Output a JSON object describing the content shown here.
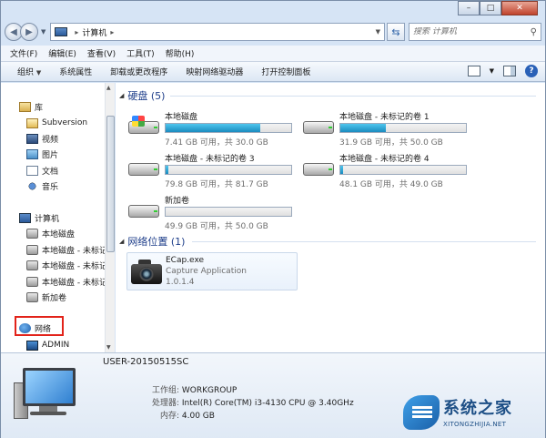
{
  "address": {
    "segments": [
      "计算机"
    ],
    "search_placeholder": "搜索 计算机"
  },
  "menubar": [
    "文件(F)",
    "编辑(E)",
    "查看(V)",
    "工具(T)",
    "帮助(H)"
  ],
  "commands": {
    "organize": "组织",
    "properties": "系统属性",
    "uninstall": "卸载或更改程序",
    "map_drive": "映射网络驱动器",
    "control_panel": "打开控制面板"
  },
  "nav": {
    "library": "库",
    "subversion": "Subversion",
    "video": "视频",
    "pictures": "图片",
    "documents": "文档",
    "music": "音乐",
    "computer": "计算机",
    "drive_local": "本地磁盘",
    "drive_unlabeled_1": "本地磁盘 - 未标记",
    "drive_unlabeled_2": "本地磁盘 - 未标记",
    "drive_unlabeled_3": "本地磁盘 - 未标记",
    "new_volume": "新加卷",
    "network": "网络",
    "admin": "ADMIN"
  },
  "groups": {
    "hard_disks": "硬盘 (5)",
    "network_locations": "网络位置 (1)"
  },
  "drives": [
    {
      "name": "本地磁盘",
      "free": "7.41 GB 可用，共 30.0 GB",
      "used_fraction": 0.75
    },
    {
      "name": "本地磁盘 - 未标记的卷 1",
      "free": "31.9 GB 可用，共 50.0 GB",
      "used_fraction": 0.36
    },
    {
      "name": "本地磁盘 - 未标记的卷 3",
      "free": "79.8 GB 可用，共 81.7 GB",
      "used_fraction": 0.02
    },
    {
      "name": "本地磁盘 - 未标记的卷 4",
      "free": "48.1 GB 可用，共 49.0 GB",
      "used_fraction": 0.02
    },
    {
      "name": "新加卷",
      "free": "49.9 GB 可用，共 50.0 GB",
      "used_fraction": 0.0
    }
  ],
  "network_item": {
    "name": "ECap.exe",
    "description": "Capture Application",
    "version": "1.0.1.4"
  },
  "details": {
    "computer_name": "USER-20150515SC",
    "workgroup_label": "工作组:",
    "workgroup": "WORKGROUP",
    "cpu_label": "处理器:",
    "cpu": "Intel(R) Core(TM) i3-4130 CPU @ 3.40GHz",
    "memory_label": "内存:",
    "memory": "4.00 GB"
  },
  "watermark": {
    "cn": "系统之家",
    "en": "XITONGZHIJIA.NET"
  },
  "colors": {
    "bar_fill": "#1a8bbf",
    "highlight": "#e2231a",
    "group_text": "#1e3e8a"
  }
}
